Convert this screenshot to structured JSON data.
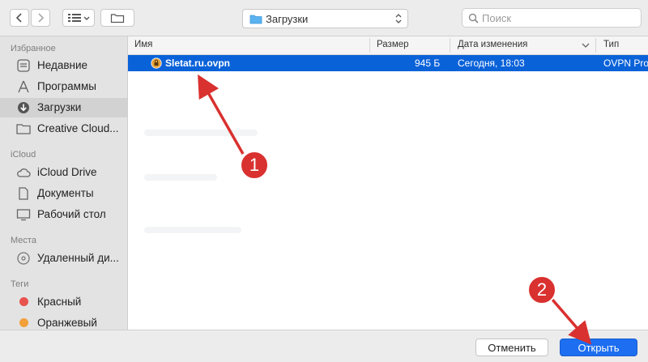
{
  "toolbar": {
    "location": "Загрузки",
    "search_placeholder": "Поиск"
  },
  "sidebar": {
    "sections": [
      {
        "title": "Избранное",
        "items": [
          {
            "label": "Недавние",
            "icon": "clock-icon"
          },
          {
            "label": "Программы",
            "icon": "applications-icon"
          },
          {
            "label": "Загрузки",
            "icon": "downloads-icon",
            "selected": true
          },
          {
            "label": "Creative Cloud...",
            "icon": "folder-icon"
          }
        ]
      },
      {
        "title": "iCloud",
        "items": [
          {
            "label": "iCloud Drive",
            "icon": "cloud-icon"
          },
          {
            "label": "Документы",
            "icon": "document-icon"
          },
          {
            "label": "Рабочий стол",
            "icon": "desktop-icon"
          }
        ]
      },
      {
        "title": "Места",
        "items": [
          {
            "label": "Удаленный ди...",
            "icon": "disc-icon"
          }
        ]
      },
      {
        "title": "Теги",
        "items": [
          {
            "label": "Красный",
            "color": "#e8534d"
          },
          {
            "label": "Оранжевый",
            "color": "#f2a03a"
          }
        ]
      }
    ]
  },
  "file_list": {
    "columns": [
      "Имя",
      "Размер",
      "Дата изменения",
      "Тип"
    ],
    "rows": [
      {
        "name": "Sletat.ru.ovpn",
        "size": "945 Б",
        "modified": "Сегодня, 18:03",
        "type": "OVPN Pro",
        "selected": true
      }
    ]
  },
  "footer": {
    "cancel_label": "Отменить",
    "open_label": "Открыть"
  },
  "annotations": {
    "badge1": "1",
    "badge2": "2",
    "color": "#d9312f"
  },
  "colors": {
    "selection": "#0a62d9",
    "primary_button": "#1d6ef0"
  }
}
